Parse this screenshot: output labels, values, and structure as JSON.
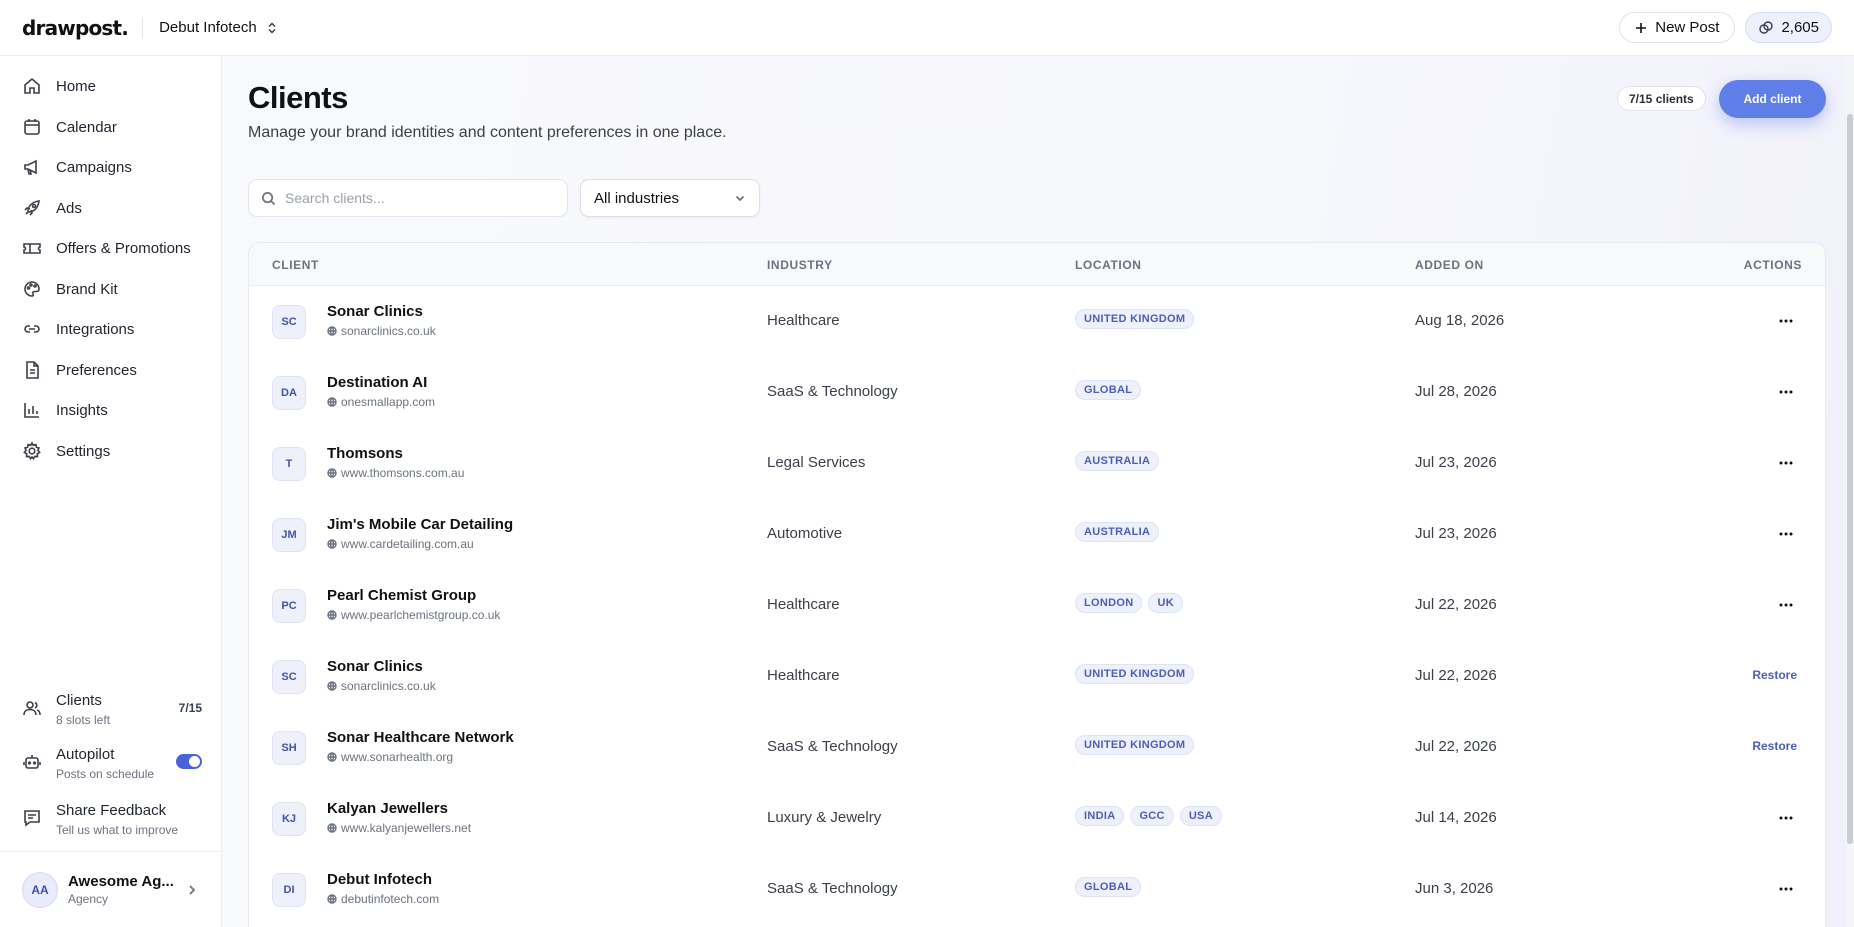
{
  "app": {
    "logo": "drawpost",
    "logo_dot": ".",
    "workspace": "Debut Infotech",
    "new_post": "New Post",
    "credits": "2,605"
  },
  "sidebar": {
    "items": [
      {
        "label": "Home",
        "icon": "home-icon"
      },
      {
        "label": "Calendar",
        "icon": "calendar-icon"
      },
      {
        "label": "Campaigns",
        "icon": "megaphone-icon"
      },
      {
        "label": "Ads",
        "icon": "rocket-icon"
      },
      {
        "label": "Offers & Promotions",
        "icon": "ticket-icon"
      },
      {
        "label": "Brand Kit",
        "icon": "palette-icon"
      },
      {
        "label": "Integrations",
        "icon": "link-icon"
      },
      {
        "label": "Preferences",
        "icon": "document-icon"
      },
      {
        "label": "Insights",
        "icon": "bar-chart-icon"
      },
      {
        "label": "Settings",
        "icon": "gear-icon"
      }
    ],
    "clients": {
      "title": "Clients",
      "sub": "8 slots left",
      "count": "7/15"
    },
    "autopilot": {
      "title": "Autopilot",
      "sub": "Posts on schedule",
      "enabled": true
    },
    "feedback": {
      "title": "Share Feedback",
      "sub": "Tell us what to improve"
    },
    "user": {
      "initials": "AA",
      "name": "Awesome Ag...",
      "role": "Agency"
    }
  },
  "page": {
    "title": "Clients",
    "subtitle": "Manage your brand identities and content preferences in one place.",
    "count_pill": "7/15 clients",
    "add_button": "Add client",
    "search_placeholder": "Search clients...",
    "industry_filter": "All industries"
  },
  "table": {
    "headers": {
      "client": "CLIENT",
      "industry": "INDUSTRY",
      "location": "LOCATION",
      "added_on": "ADDED ON",
      "actions": "ACTIONS"
    },
    "rows": [
      {
        "initials": "SC",
        "name": "Sonar Clinics",
        "site": "sonarclinics.co.uk",
        "industry": "Healthcare",
        "tags": [
          "UNITED KINGDOM"
        ],
        "date": "Aug 18, 2026",
        "action": "menu"
      },
      {
        "initials": "DA",
        "name": "Destination AI",
        "site": "onesmallapp.com",
        "industry": "SaaS & Technology",
        "tags": [
          "GLOBAL"
        ],
        "date": "Jul 28, 2026",
        "action": "menu"
      },
      {
        "initials": "T",
        "name": "Thomsons",
        "site": "www.thomsons.com.au",
        "industry": "Legal Services",
        "tags": [
          "AUSTRALIA"
        ],
        "date": "Jul 23, 2026",
        "action": "menu"
      },
      {
        "initials": "JM",
        "name": "Jim's Mobile Car Detailing",
        "site": "www.cardetailing.com.au",
        "industry": "Automotive",
        "tags": [
          "AUSTRALIA"
        ],
        "date": "Jul 23, 2026",
        "action": "menu"
      },
      {
        "initials": "PC",
        "name": "Pearl Chemist Group",
        "site": "www.pearlchemistgroup.co.uk",
        "industry": "Healthcare",
        "tags": [
          "LONDON",
          "UK"
        ],
        "date": "Jul 22, 2026",
        "action": "menu"
      },
      {
        "initials": "SC",
        "name": "Sonar Clinics",
        "site": "sonarclinics.co.uk",
        "industry": "Healthcare",
        "tags": [
          "UNITED KINGDOM"
        ],
        "date": "Jul 22, 2026",
        "action": "Restore"
      },
      {
        "initials": "SH",
        "name": "Sonar Healthcare Network",
        "site": "www.sonarhealth.org",
        "industry": "SaaS & Technology",
        "tags": [
          "UNITED KINGDOM"
        ],
        "date": "Jul 22, 2026",
        "action": "Restore"
      },
      {
        "initials": "KJ",
        "name": "Kalyan Jewellers",
        "site": "www.kalyanjewellers.net",
        "industry": "Luxury & Jewelry",
        "tags": [
          "INDIA",
          "GCC",
          "USA"
        ],
        "date": "Jul 14, 2026",
        "action": "menu"
      },
      {
        "initials": "DI",
        "name": "Debut Infotech",
        "site": "debutinfotech.com",
        "industry": "SaaS & Technology",
        "tags": [
          "GLOBAL"
        ],
        "date": "Jun 3, 2026",
        "action": "menu"
      }
    ]
  },
  "colors": {
    "accent": "#5f7ee8",
    "tag_text": "#4b5fb8",
    "toggle_on": "#4b63d8"
  }
}
